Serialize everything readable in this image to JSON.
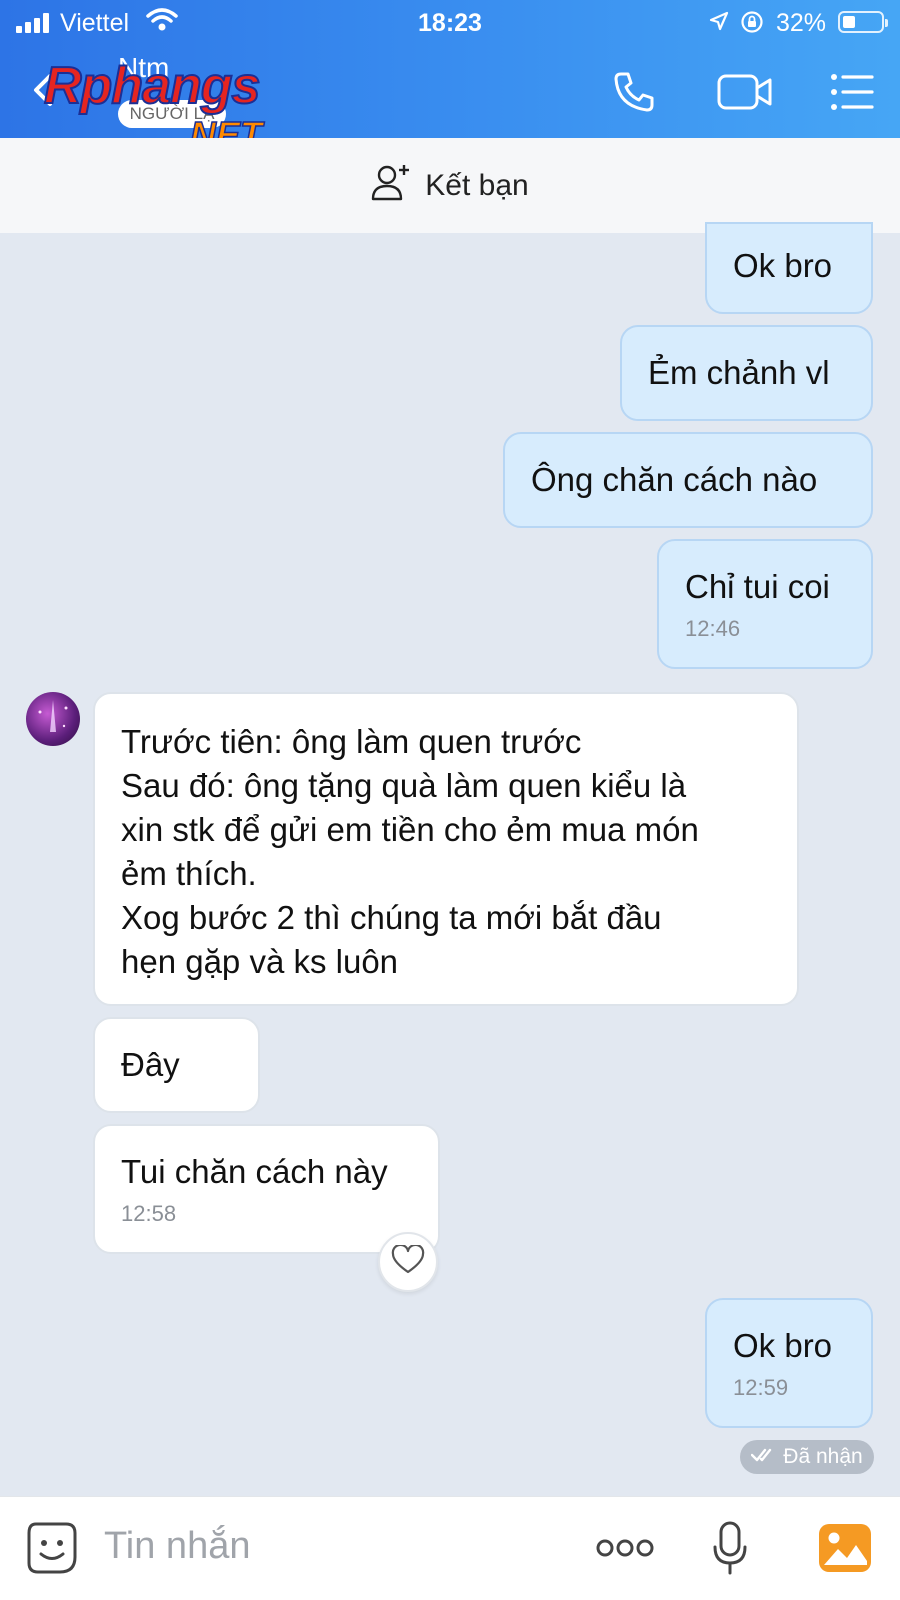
{
  "status_bar": {
    "carrier": "Viettel",
    "time": "18:23",
    "battery": "32%"
  },
  "header": {
    "contact_name": "Ntm",
    "contact_status": "NGƯỜI LẠ",
    "watermark_main": "Rphangs",
    "watermark_net": ".NET"
  },
  "friend_bar": {
    "label": "Kết bạn"
  },
  "messages": [
    {
      "dir": "out",
      "text": "Ok bro"
    },
    {
      "dir": "out",
      "text": "Ẻm chảnh vl"
    },
    {
      "dir": "out",
      "text": "Ông chăn cách nào"
    },
    {
      "dir": "out",
      "text": "Chỉ tui coi",
      "time": "12:46"
    },
    {
      "dir": "in",
      "text": "Trước tiên: ông làm quen trước\nSau đó: ông tặng quà làm quen kiểu là\nxin stk để gửi em tiền cho ẻm mua món\nẻm thích.\nXog bước 2 thì chúng ta mới bắt đầu\nhẹn gặp và ks luôn"
    },
    {
      "dir": "in",
      "text": "Đây"
    },
    {
      "dir": "in",
      "text": "Tui chăn cách này",
      "time": "12:58"
    },
    {
      "dir": "out",
      "text": "Ok bro",
      "time": "12:59"
    }
  ],
  "delivery_status": "Đã nhận",
  "composer": {
    "placeholder": "Tin nhắn"
  },
  "colors": {
    "header_start": "#2d74e6",
    "header_end": "#46a6f5",
    "bubble_out": "#d7ecfd",
    "bubble_in": "#ffffff",
    "chat_bg": "#e2e8f1"
  },
  "icons": [
    "back-icon",
    "phone-icon",
    "video-call-icon",
    "menu-icon",
    "add-friend-icon",
    "heart-icon",
    "double-check-icon",
    "sticker-icon",
    "more-icon",
    "microphone-icon",
    "image-icon"
  ]
}
